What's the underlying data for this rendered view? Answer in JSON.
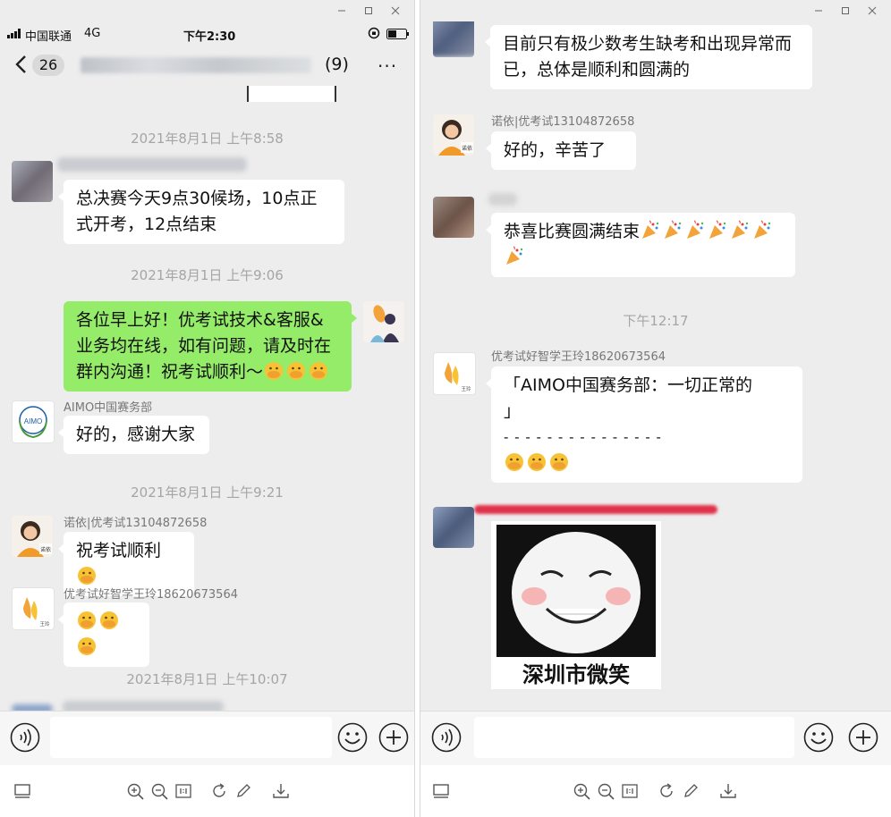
{
  "left": {
    "status": {
      "carrier": "中国联通",
      "network": "4G",
      "time": "下午2:30"
    },
    "nav": {
      "unread": "26",
      "members": "(9)",
      "more": "···"
    },
    "messages": {
      "ts1": "2021年8月1日 上午8:58",
      "m1_text": "总决赛今天9点30候场，10点正式开考，12点结束",
      "ts2": "2021年8月1日 上午9:06",
      "m2_text": "各位早上好！优考试技术&客服&业务均在线，如有问题，请及时在群内沟通！祝考试顺利～",
      "m3_sender": "AIMO中国赛务部",
      "m3_avatar_text": "AIMO",
      "m3_text": "好的，感谢大家",
      "ts3": "2021年8月1日 上午9:21",
      "m4_sender": "诺依|优考试13104872658",
      "m4_text": "祝考试顺利",
      "avatar_tag_nuoyi": "诺依",
      "m5_sender": "优考试好智学王玲18620673564",
      "avatar_tag_wangling": "王玲",
      "ts4": "2021年8月1日 上午10:07"
    }
  },
  "right": {
    "messages": {
      "r1_text": "目前只有极少数考生缺考和出现异常而已，总体是顺利和圆满的",
      "r2_sender": "诺依|优考试13104872658",
      "r2_text": "好的，辛苦了",
      "r3_text": "恭喜比赛圆满结束",
      "ts5": "下午12:17",
      "r4_sender": "优考试好智学王玲18620673564",
      "r4_line1": "「AIMO中国赛务部：一切正常的",
      "r4_line2": "」",
      "r4_line3": "- - - - - - - - - - - - - - -",
      "sticker_caption": "深圳市微笑"
    }
  },
  "colors": {
    "chat_bg": "#ededed",
    "my_bubble": "#95ec69",
    "other_bubble": "#ffffff",
    "timestamp": "#a5a5a5"
  }
}
